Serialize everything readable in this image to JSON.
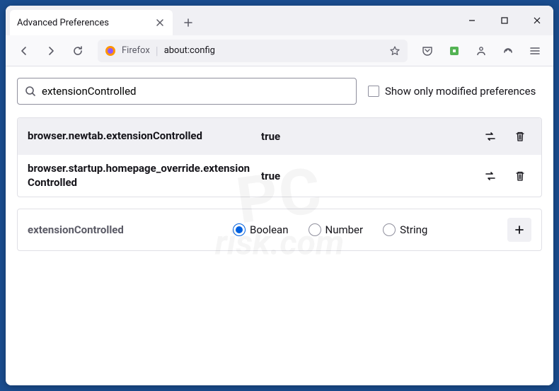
{
  "tab": {
    "title": "Advanced Preferences"
  },
  "urlbar": {
    "prefix": "Firefox",
    "url": "about:config"
  },
  "search": {
    "value": "extensionControlled"
  },
  "filter": {
    "label": "Show only modified preferences"
  },
  "prefs": [
    {
      "name": "browser.newtab.extensionControlled",
      "value": "true"
    },
    {
      "name": "browser.startup.homepage_override.extensionControlled",
      "value": "true"
    }
  ],
  "add": {
    "name": "extensionControlled",
    "types": [
      {
        "label": "Boolean",
        "selected": true
      },
      {
        "label": "Number",
        "selected": false
      },
      {
        "label": "String",
        "selected": false
      }
    ]
  }
}
